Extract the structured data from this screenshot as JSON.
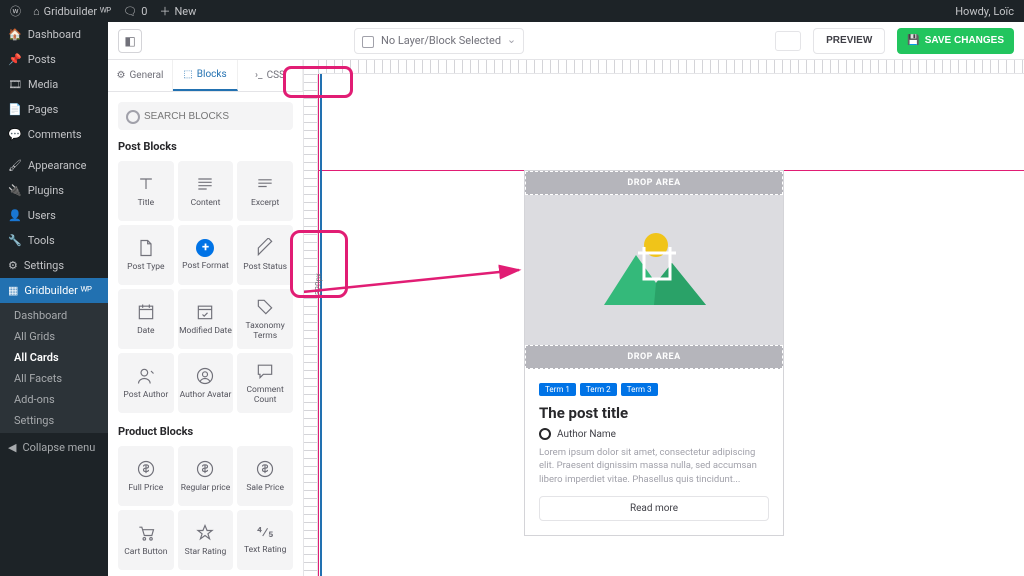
{
  "wp_bar": {
    "site": "Gridbuilder ᵂᴾ",
    "comments": "0",
    "new": "New",
    "howdy": "Howdy, Loïc"
  },
  "wp_menu": {
    "dashboard": "Dashboard",
    "posts": "Posts",
    "media": "Media",
    "pages": "Pages",
    "comments": "Comments",
    "appearance": "Appearance",
    "plugins": "Plugins",
    "users": "Users",
    "tools": "Tools",
    "settings": "Settings",
    "gridbuilder": "Gridbuilder ᵂᴾ",
    "sub": {
      "dashboard": "Dashboard",
      "all_grids": "All Grids",
      "all_cards": "All Cards",
      "all_facets": "All Facets",
      "addons": "Add-ons",
      "settings": "Settings"
    },
    "collapse": "Collapse menu"
  },
  "topbar": {
    "no_layer": "No Layer/Block Selected",
    "preview": "PREVIEW",
    "save": "SAVE CHANGES"
  },
  "panel": {
    "tabs": {
      "general": "General",
      "blocks": "Blocks",
      "css": "CSS"
    },
    "search_ph": "SEARCH BLOCKS",
    "sect_post": "Post Blocks",
    "sect_product": "Product Blocks",
    "blocks_post": [
      "Title",
      "Content",
      "Excerpt",
      "Post Type",
      "Post Format",
      "Post Status",
      "Date",
      "Modified Date",
      "Taxonomy Terms",
      "Post Author",
      "Author Avatar",
      "Comment Count"
    ],
    "blocks_product": [
      "Full Price",
      "Regular price",
      "Sale Price",
      "Cart Button",
      "Star Rating",
      "Text Rating"
    ]
  },
  "card": {
    "drop": "DROP AREA",
    "terms": [
      "Term 1",
      "Term 2",
      "Term 3"
    ],
    "title": "The post title",
    "author": "Author Name",
    "lorem": "Lorem ipsum dolor sit amet, consectetur adipiscing elit. Praesent dignissim massa nulla, sed accumsan libero imperdiet vitae. Phasellus quis tincidunt...",
    "readmore": "Read more"
  },
  "ruler": {
    "label": "320px"
  }
}
